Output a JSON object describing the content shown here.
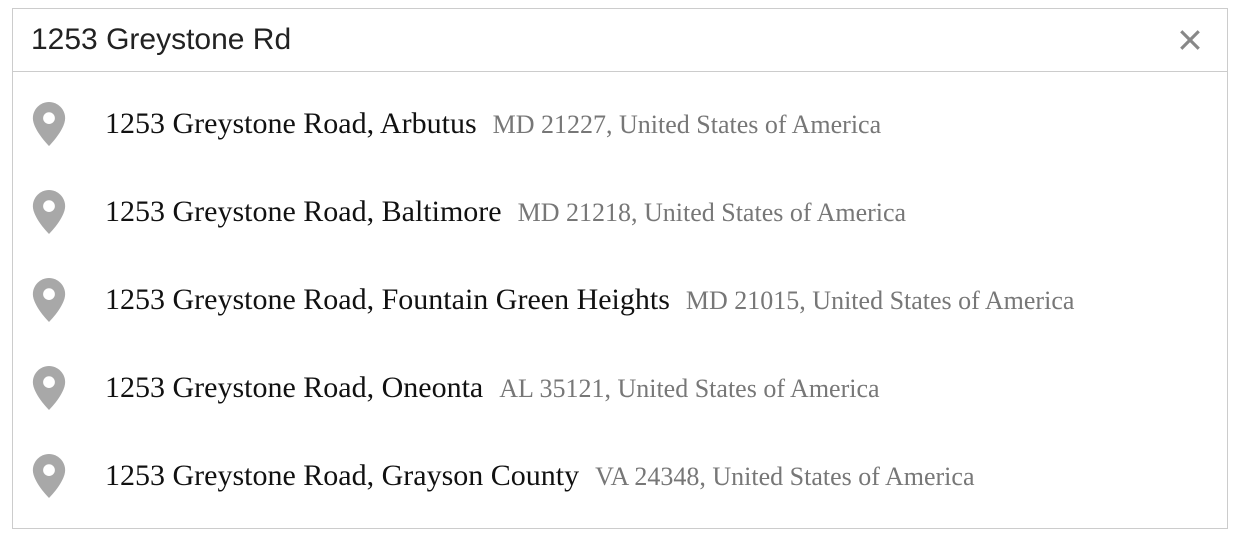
{
  "search": {
    "value": "1253 Greystone Rd",
    "placeholder": ""
  },
  "suggestions": [
    {
      "main": "1253 Greystone Road, Arbutus",
      "secondary": "MD 21227, United States of America"
    },
    {
      "main": "1253 Greystone Road, Baltimore",
      "secondary": "MD 21218, United States of America"
    },
    {
      "main": "1253 Greystone Road, Fountain Green Heights",
      "secondary": "MD 21015, United States of America"
    },
    {
      "main": "1253 Greystone Road, Oneonta",
      "secondary": "AL 35121, United States of America"
    },
    {
      "main": "1253 Greystone Road, Grayson County",
      "secondary": "VA 24348, United States of America"
    }
  ]
}
